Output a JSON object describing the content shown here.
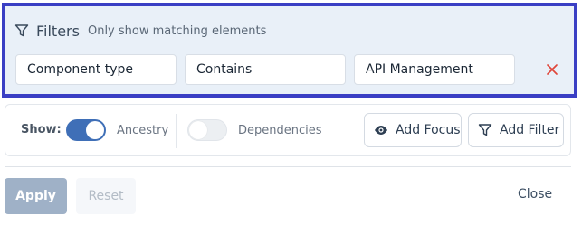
{
  "filters": {
    "title": "Filters",
    "subtitle": "Only show matching elements",
    "icon": "filter-icon",
    "accent_border": "#3a3fc4",
    "condition": {
      "field": "Component type",
      "operator": "Contains",
      "value": "API Management",
      "remove_icon": "close-icon",
      "remove_color": "#e0463a"
    }
  },
  "controls": {
    "show_label": "Show:",
    "ancestry": {
      "label": "Ancestry",
      "enabled": true
    },
    "dependencies": {
      "label": "Dependencies",
      "enabled": false
    },
    "add_focus": {
      "label": "Add Focus",
      "icon": "eye-icon"
    },
    "add_filter": {
      "label": "Add Filter",
      "icon": "filter-icon"
    }
  },
  "footer": {
    "apply_label": "Apply",
    "reset_label": "Reset",
    "close_label": "Close"
  }
}
